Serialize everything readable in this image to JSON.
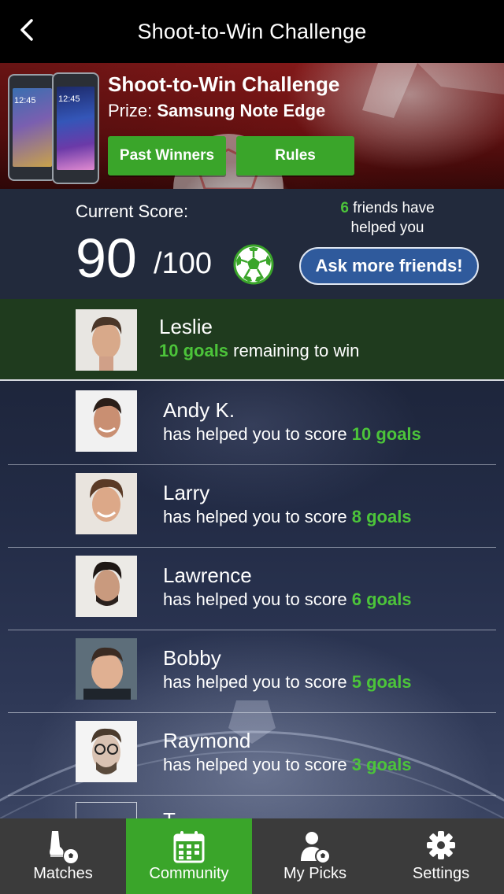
{
  "nav": {
    "title": "Shoot-to-Win Challenge",
    "back_icon": "chevron-left-icon"
  },
  "banner": {
    "title": "Shoot-to-Win Challenge",
    "prize_label": "Prize:",
    "prize_value": "Samsung Note Edge",
    "phone_time_1": "12:45",
    "phone_time_2": "12:45",
    "past_winners_label": "Past Winners",
    "rules_label": "Rules"
  },
  "score": {
    "label": "Current Score:",
    "value": "90",
    "out_of": "/100",
    "friends_count": "6",
    "friends_text_1": "friends have",
    "friends_text_2": "helped you",
    "ask_label": "Ask more friends!"
  },
  "me": {
    "name": "Leslie",
    "goals": "10 goals",
    "suffix": "remaining to win"
  },
  "helpers_prefix": "has helped you to score",
  "helpers": [
    {
      "name": "Andy K.",
      "goals": "10 goals"
    },
    {
      "name": "Larry",
      "goals": "8 goals"
    },
    {
      "name": "Lawrence",
      "goals": "6 goals"
    },
    {
      "name": "Bobby",
      "goals": "5 goals"
    },
    {
      "name": "Raymond",
      "goals": "3 goals"
    }
  ],
  "partial_row_name": "T",
  "tabs": [
    {
      "label": "Matches",
      "icon": "boot-ball-icon",
      "active": false
    },
    {
      "label": "Community",
      "icon": "calendar-icon",
      "active": true
    },
    {
      "label": "My Picks",
      "icon": "person-ball-icon",
      "active": false
    },
    {
      "label": "Settings",
      "icon": "gear-icon",
      "active": false
    }
  ],
  "colors": {
    "accent_green": "#3aa52a",
    "highlight_green": "#4cc43a",
    "ask_blue": "#2f5a9c",
    "score_bg": "#222a3c"
  }
}
